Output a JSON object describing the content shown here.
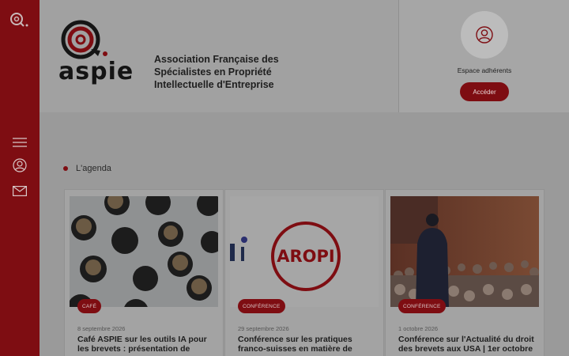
{
  "header": {
    "brand_lines": [
      "Association Française des",
      "Spécialistes en Propriété",
      "Intellectuelle d'Entreprise"
    ],
    "logo_icon": "aspie-logo",
    "logo_wordmark": "aspie"
  },
  "member": {
    "title": "Espace adhérents",
    "button_label": "Accéder"
  },
  "rail": {
    "icons": [
      "search-icon",
      "menu-icon",
      "user-icon",
      "mail-icon"
    ]
  },
  "agenda": {
    "label": "L'agenda",
    "cards": [
      {
        "tag": "CAFÉ",
        "date": "8 septembre 2026",
        "title": "Café ASPIE sur les outils IA pour les brevets : présentation de",
        "image": "coffee-cups-image"
      },
      {
        "tag": "CONFÉRENCE",
        "date": "29 septembre 2026",
        "title": "Conférence sur les pratiques franco-suisses en matière de",
        "image": "aropi-logo-image",
        "image_text": "AROPI"
      },
      {
        "tag": "CONFÉRENCE",
        "date": "1 octobre 2026",
        "title": "Conférence sur l'Actualité du droit des brevets aux USA | 1er octobre",
        "image": "conference-audience-image"
      }
    ]
  },
  "colors": {
    "brand_red": "#7e0d12",
    "overlay_gray": "#9b9b9b"
  }
}
